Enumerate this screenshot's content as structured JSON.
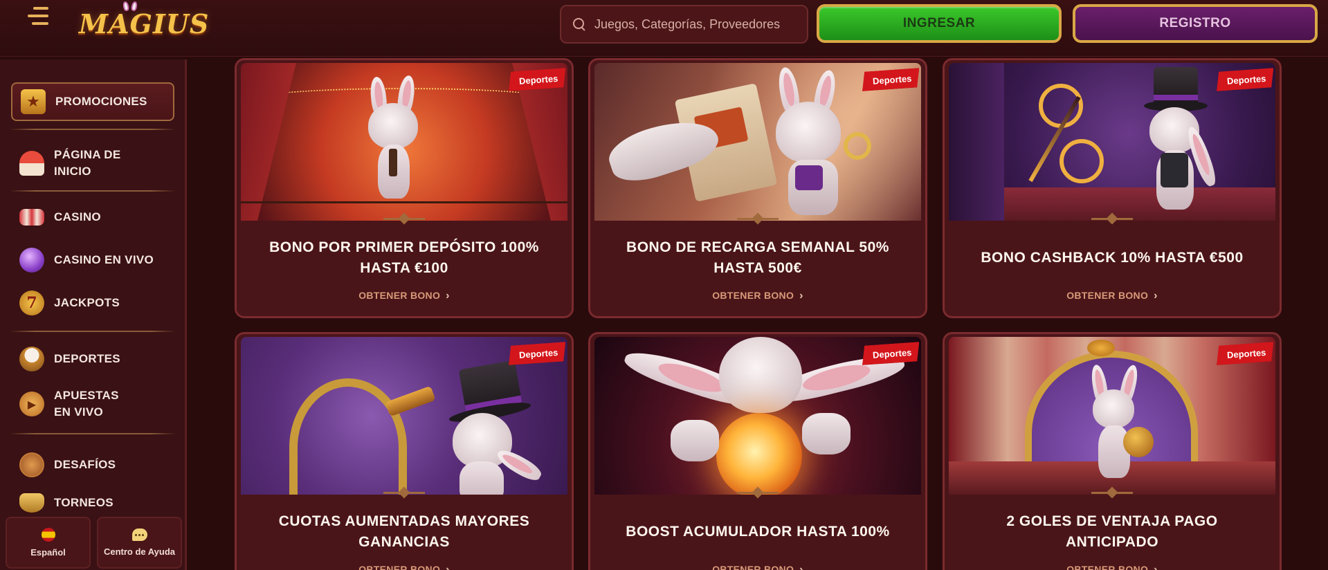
{
  "header": {
    "logo_text": "MAGIUS",
    "search_placeholder": "Juegos, Categorías, Proveedores",
    "login_label": "INGRESAR",
    "register_label": "REGISTRO"
  },
  "sidebar": {
    "items": [
      {
        "label": "PROMOCIONES",
        "icon": "star-gift-icon",
        "active": true
      },
      {
        "label": "PÁGINA DE INICIO",
        "icon": "circus-tent-icon"
      },
      {
        "label": "CASINO",
        "icon": "slot-reels-icon"
      },
      {
        "label": "CASINO EN VIVO",
        "icon": "crystal-ball-icon"
      },
      {
        "label": "JACKPOTS",
        "icon": "lucky-seven-icon"
      },
      {
        "label": "DEPORTES",
        "icon": "trophy-ball-icon"
      },
      {
        "label": "APUESTAS EN VIVO",
        "icon": "live-play-icon"
      },
      {
        "label": "DESAFÍOS",
        "icon": "challenge-medal-icon"
      },
      {
        "label": "TORNEOS",
        "icon": "tournament-trophy-icon"
      }
    ],
    "language_label": "Español",
    "help_label": "Centro de Ayuda"
  },
  "promotions": {
    "cta_label": "OBTENER BONO",
    "cards": [
      {
        "tag": "Deportes",
        "title": "BONO POR PRIMER DEPÓSITO 100% HASTA €100"
      },
      {
        "tag": "Deportes",
        "title": "BONO DE RECARGA SEMANAL 50% HASTA 500€"
      },
      {
        "tag": "Deportes",
        "title": "BONO CASHBACK 10% HASTA €500"
      },
      {
        "tag": "Deportes",
        "title": "CUOTAS AUMENTADAS MAYORES GANANCIAS"
      },
      {
        "tag": "Deportes",
        "title": "BOOST ACUMULADOR HASTA 100%"
      },
      {
        "tag": "Deportes",
        "title": "2 GOLES DE VENTAJA PAGO ANTICIPADO"
      }
    ]
  },
  "colors": {
    "background": "#2a0b0c",
    "card": "#4a1519",
    "accent_gold": "#d9a846",
    "tag_red": "#d3161b",
    "login_green": "#2aa81f",
    "register_purple": "#5a1a5c"
  }
}
